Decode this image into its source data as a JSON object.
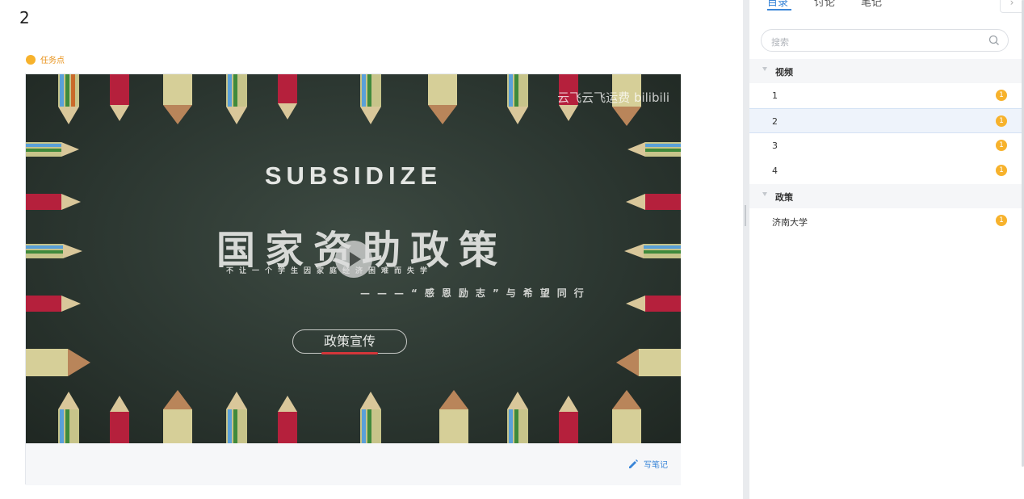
{
  "main": {
    "title": "2",
    "task_point_label": "任务点",
    "video": {
      "watermark": "云飞云飞运费 bilibili",
      "english_title": "SUBSIDIZE",
      "headline": "国家资助政策",
      "subline": "不让一个学生因家庭经济困难而失学",
      "motto": "———“感恩励志”与希望同行",
      "policy_label": "政策宣传"
    },
    "write_note_label": "写笔记"
  },
  "sidebar": {
    "tabs": [
      {
        "label": "目录"
      },
      {
        "label": "讨论"
      },
      {
        "label": "笔记"
      }
    ],
    "collapse_icon": "›",
    "search_placeholder": "搜索",
    "groups": [
      {
        "label": "视频",
        "items": [
          {
            "label": "1",
            "badge": "1"
          },
          {
            "label": "2",
            "badge": "1"
          },
          {
            "label": "3",
            "badge": "1"
          },
          {
            "label": "4",
            "badge": "1"
          }
        ]
      },
      {
        "label": "政策",
        "items": [
          {
            "label": "济南大学",
            "badge": "1"
          }
        ]
      }
    ]
  },
  "colors": {
    "accent": "#3a86d8",
    "badge": "#f7b22c",
    "chalkboard": "#2c3731"
  }
}
